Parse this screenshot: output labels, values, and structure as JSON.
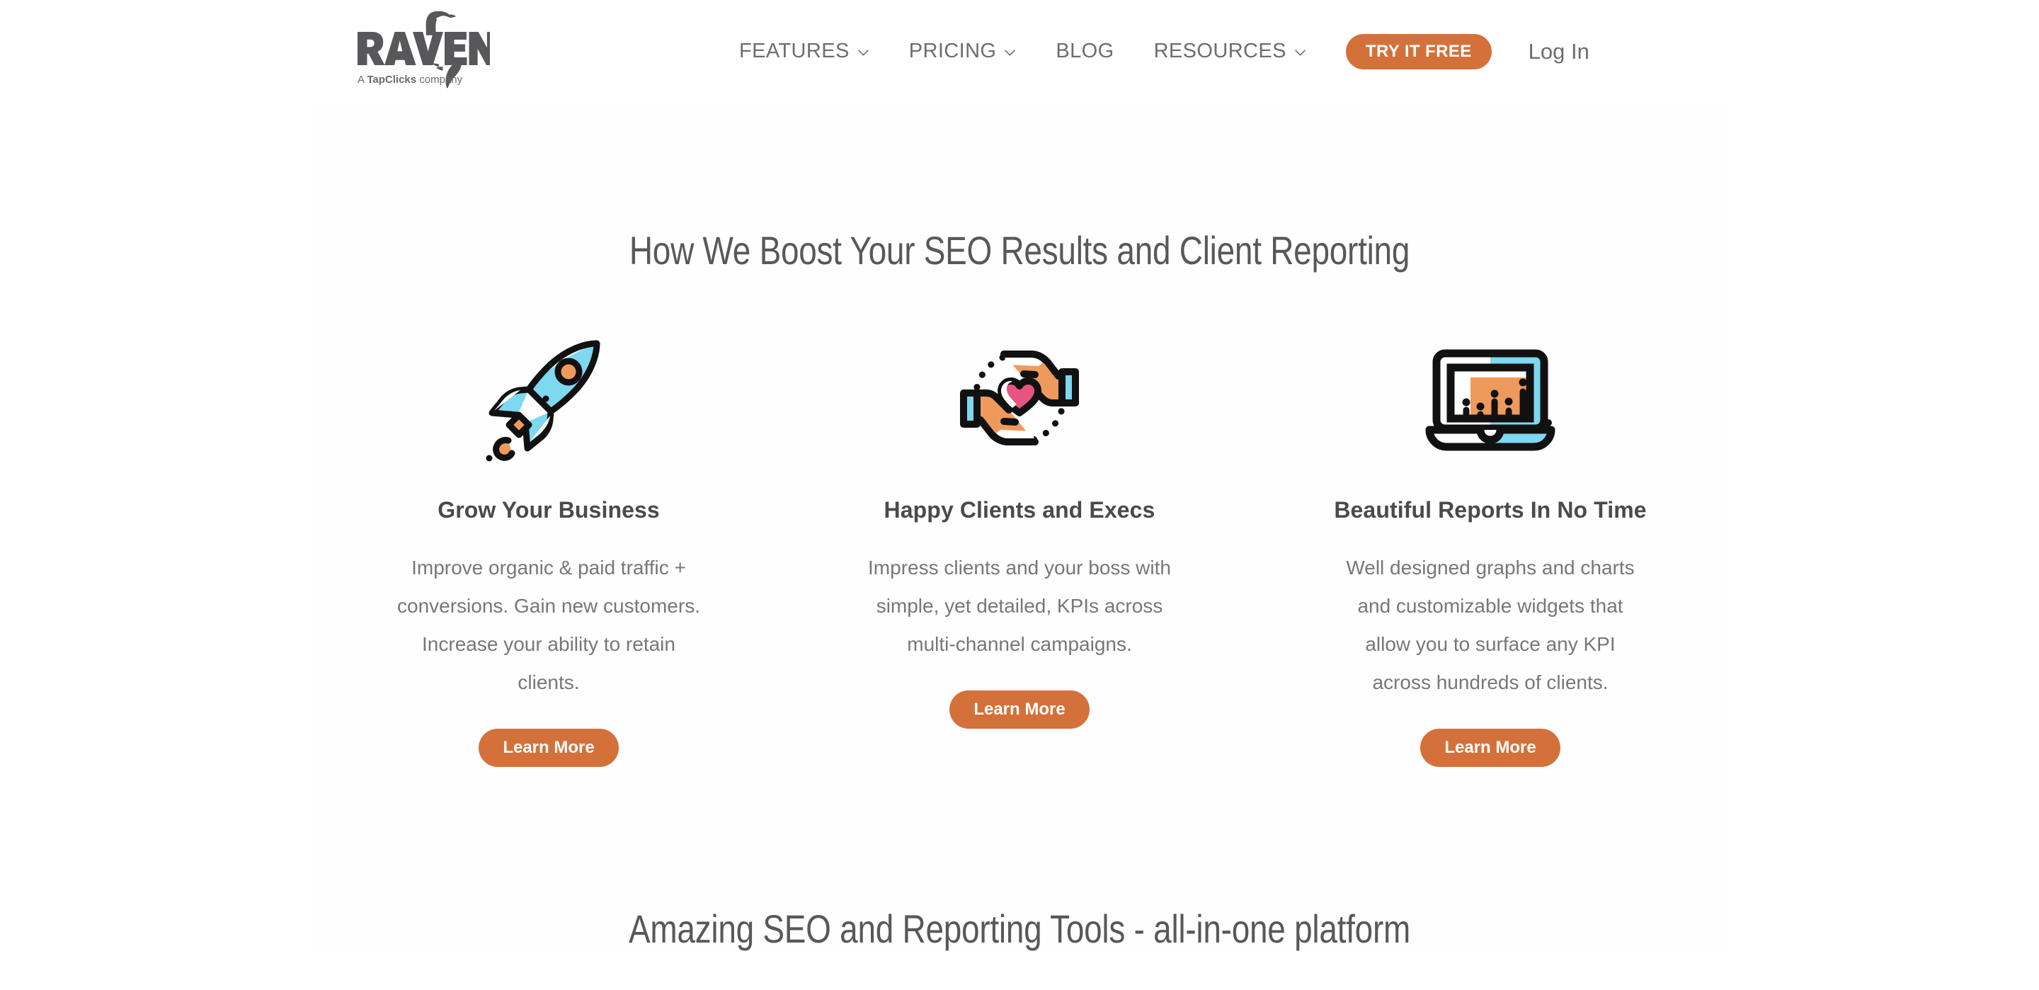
{
  "header": {
    "logo": {
      "wordmark": "RAVEN",
      "tagline_prefix": "A ",
      "tagline_brand": "TapClicks",
      "tagline_suffix": " company"
    },
    "nav": [
      {
        "label": "FEATURES",
        "has_dropdown": true,
        "icon": "chevron-down-icon"
      },
      {
        "label": "PRICING",
        "has_dropdown": true,
        "icon": "chevron-down-icon"
      },
      {
        "label": "BLOG",
        "has_dropdown": false,
        "icon": ""
      },
      {
        "label": "RESOURCES",
        "has_dropdown": true,
        "icon": "chevron-down-icon"
      }
    ],
    "cta_label": "TRY IT FREE",
    "login_label": "Log In"
  },
  "features_section": {
    "heading": "How We Boost Your SEO Results and Client Reporting",
    "cards": [
      {
        "icon": "rocket-icon",
        "title": "Grow Your Business",
        "body": "Improve organic & paid traffic + conversions. Gain new customers. Increase your ability to retain clients.",
        "cta_label": "Learn More"
      },
      {
        "icon": "hands-heart-icon",
        "title": "Happy Clients and Execs",
        "body": "Impress clients and your boss with simple, yet detailed, KPIs across multi-channel campaigns.",
        "cta_label": "Learn More"
      },
      {
        "icon": "laptop-chart-icon",
        "title": "Beautiful Reports In No Time",
        "body": "Well designed graphs and charts and customizable widgets that allow you to surface any KPI across hundreds of clients.",
        "cta_label": "Learn More"
      }
    ]
  },
  "tools_section": {
    "heading": "Amazing SEO and Reporting Tools - all-in-one platform"
  },
  "colors": {
    "accent_orange": "#d4713a",
    "icon_blue": "#7dd8f0",
    "icon_orange": "#ef9a5d",
    "icon_pink": "#e8547f",
    "heading_gray": "#585858",
    "body_gray": "#777777",
    "nav_gray": "#6d6d6d"
  }
}
